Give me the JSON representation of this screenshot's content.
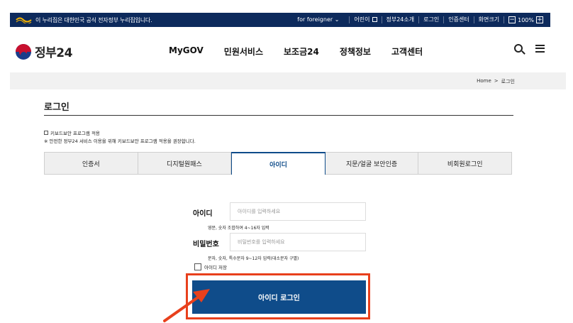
{
  "topbar": {
    "notice": "이 누리집은 대한민국 공식 전자정부 누리집입니다.",
    "foreigner": "for foreigner",
    "links": [
      "어린이",
      "정부24소개",
      "로그인",
      "인증센터",
      "화면크기"
    ],
    "zoom_minus": "−",
    "zoom_value": "100%",
    "zoom_plus": "+"
  },
  "header": {
    "logo_text": "정부24",
    "nav": [
      "MyGOV",
      "민원서비스",
      "보조금24",
      "정책정보",
      "고객센터"
    ]
  },
  "breadcrumb": {
    "home": "Home",
    "sep": ">",
    "current": "로그인"
  },
  "page": {
    "title": "로그인",
    "keyboard_label": "키보드보안 프로그램 적용",
    "keyboard_note": "※ 안전한 정부24 서비스 이용을 위해 키보드보안 프로그램 적용을 권장합니다."
  },
  "tabs": [
    "인증서",
    "디지털원패스",
    "아이디",
    "지문/얼굴 보안인증",
    "비회원로그인"
  ],
  "active_tab": "아이디",
  "form": {
    "id_label": "아이디",
    "id_placeholder": "아이디를 입력하세요",
    "id_hint": "영문, 숫자 조합하여 4~16자 입력",
    "pw_label": "비밀번호",
    "pw_placeholder": "비밀번호를 입력하세요",
    "pw_hint": "문자, 숫자, 특수문자 9~12자 입력(대소문자 구별)",
    "save_label": "아이디 저장",
    "login_button": "아이디 로그인"
  },
  "colors": {
    "topbar": "#0d2a5c",
    "primary": "#0f4c8a",
    "highlight": "#e8401c"
  }
}
